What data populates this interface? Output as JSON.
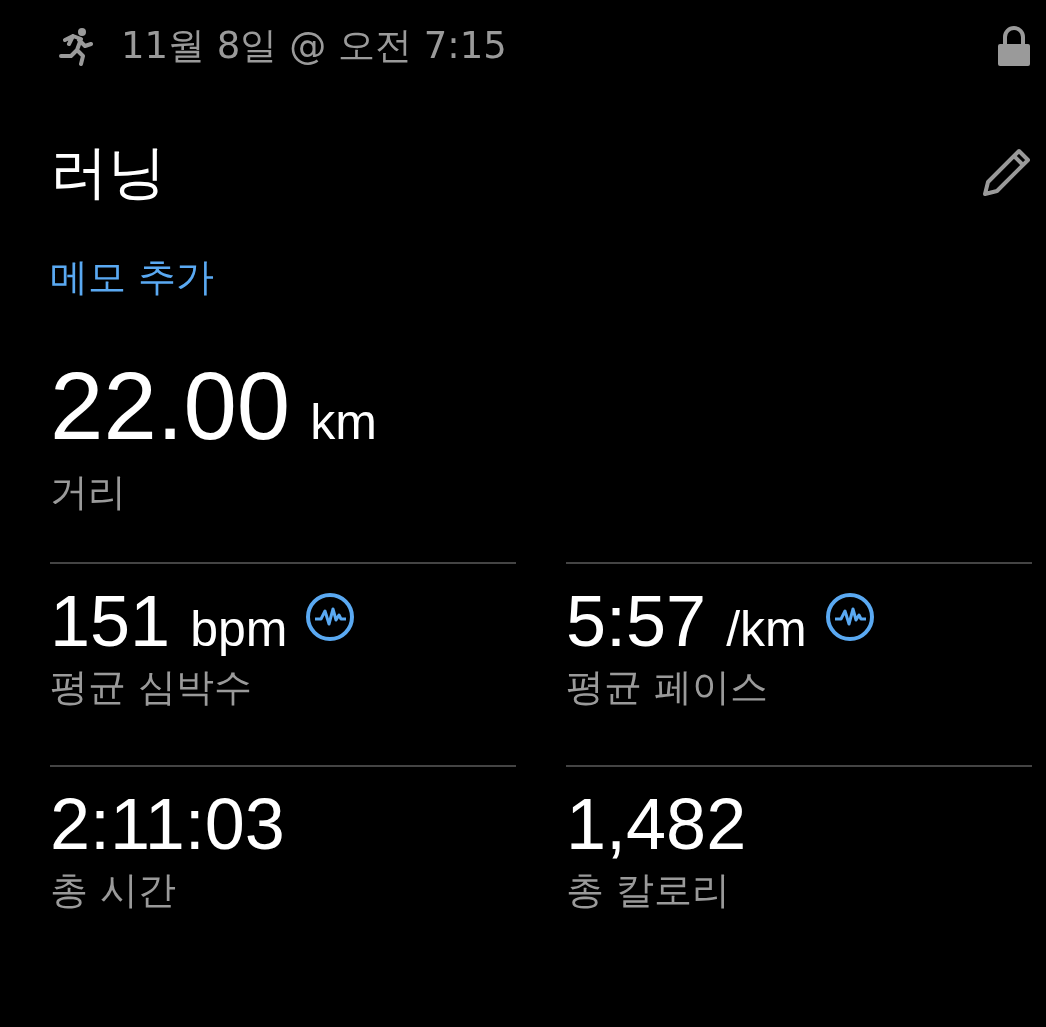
{
  "status": {
    "date": "11월 8일 @ 오전 7:15",
    "locked": true
  },
  "title": "러닝",
  "memo_link": "메모 추가",
  "distance": {
    "value": "22.00",
    "unit": "km",
    "label": "거리"
  },
  "stats": [
    {
      "value": "151",
      "unit": "bpm",
      "label": "평균 심박수",
      "has_chart": true
    },
    {
      "value": "5:57",
      "unit": "/km",
      "label": "평균 페이스",
      "has_chart": true
    },
    {
      "value": "2:11:03",
      "label": "총 시간",
      "has_chart": false
    },
    {
      "value": "1,482",
      "label": "총 칼로리",
      "has_chart": false
    }
  ]
}
